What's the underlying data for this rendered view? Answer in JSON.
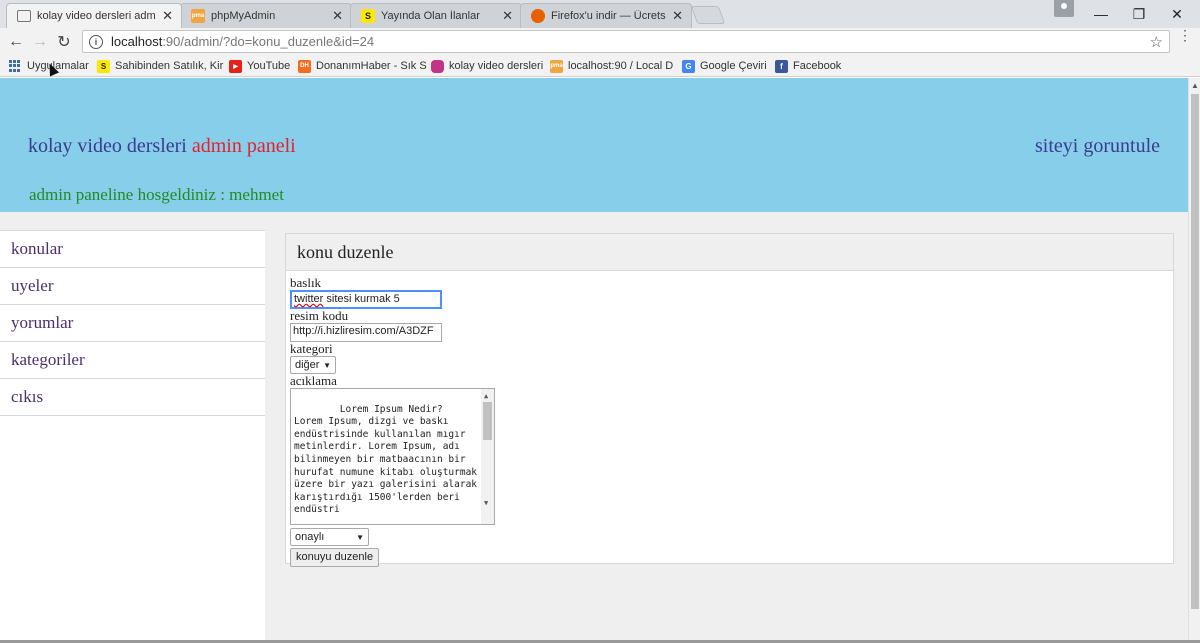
{
  "browser": {
    "tabs": [
      {
        "title": "kolay video dersleri adm",
        "active": true,
        "favicon": "page-icon"
      },
      {
        "title": "phpMyAdmin",
        "active": false,
        "favicon": "phpmyadmin-icon"
      },
      {
        "title": "Yayında Olan İlanlar",
        "active": false,
        "favicon": "sahibinden-icon"
      },
      {
        "title": "Firefox'u indir — Ücretsi",
        "active": false,
        "favicon": "firefox-icon"
      }
    ],
    "url_host": "localhost",
    "url_path": ":90/admin/?do=konu_duzenle&id=24",
    "bookmarks": [
      {
        "label": "Uygulamalar",
        "icon": "apps-grid-icon"
      },
      {
        "label": "Sahibinden Satılık, Kir",
        "icon": "sahibinden-icon"
      },
      {
        "label": "YouTube",
        "icon": "youtube-icon"
      },
      {
        "label": "DonanımHaber - Sık S",
        "icon": "donanimhaber-icon"
      },
      {
        "label": "kolay video dersleri",
        "icon": "instagram-icon"
      },
      {
        "label": "localhost:90 / Local D",
        "icon": "phpmyadmin-icon"
      },
      {
        "label": "Google Çeviri",
        "icon": "google-translate-icon"
      },
      {
        "label": "Facebook",
        "icon": "facebook-icon"
      }
    ]
  },
  "header": {
    "title_part1": "kolay video dersleri",
    "title_part2": "admin paneli",
    "view_site": "siteyi goruntule",
    "welcome": "admin paneline hosgeldiniz : mehmet"
  },
  "sidebar": {
    "items": [
      {
        "label": "konular"
      },
      {
        "label": "uyeler"
      },
      {
        "label": "yorumlar"
      },
      {
        "label": "kategoriler"
      },
      {
        "label": "cıkıs"
      }
    ]
  },
  "panel": {
    "heading": "konu duzenle",
    "fields": {
      "title_label": "baslık",
      "title_value_word1": "twitter",
      "title_value_rest": " sitesi kurmak 5",
      "image_label": "resim kodu",
      "image_value": "http://i.hizliresim.com/A3DZF",
      "category_label": "kategori",
      "category_value": "diğer",
      "description_label": "acıklama",
      "description_value": "Lorem Ipsum Nedir?\nLorem Ipsum, dizgi ve baskı endüstrisinde kullanılan mıgır metinlerdir. Lorem Ipsum, adı bilinmeyen bir matbaacının bir hurufat numune kitabı oluşturmak üzere bir yazı galerisini alarak karıştırdığı 1500'lerden beri endüstri",
      "status_value": "onaylı",
      "submit_label": "konuyu duzenle"
    }
  },
  "colors": {
    "header_bg": "#87ceeb",
    "title_red": "#e8202c",
    "welcome_green": "#228b22",
    "link_purple": "#4a2f6d"
  }
}
